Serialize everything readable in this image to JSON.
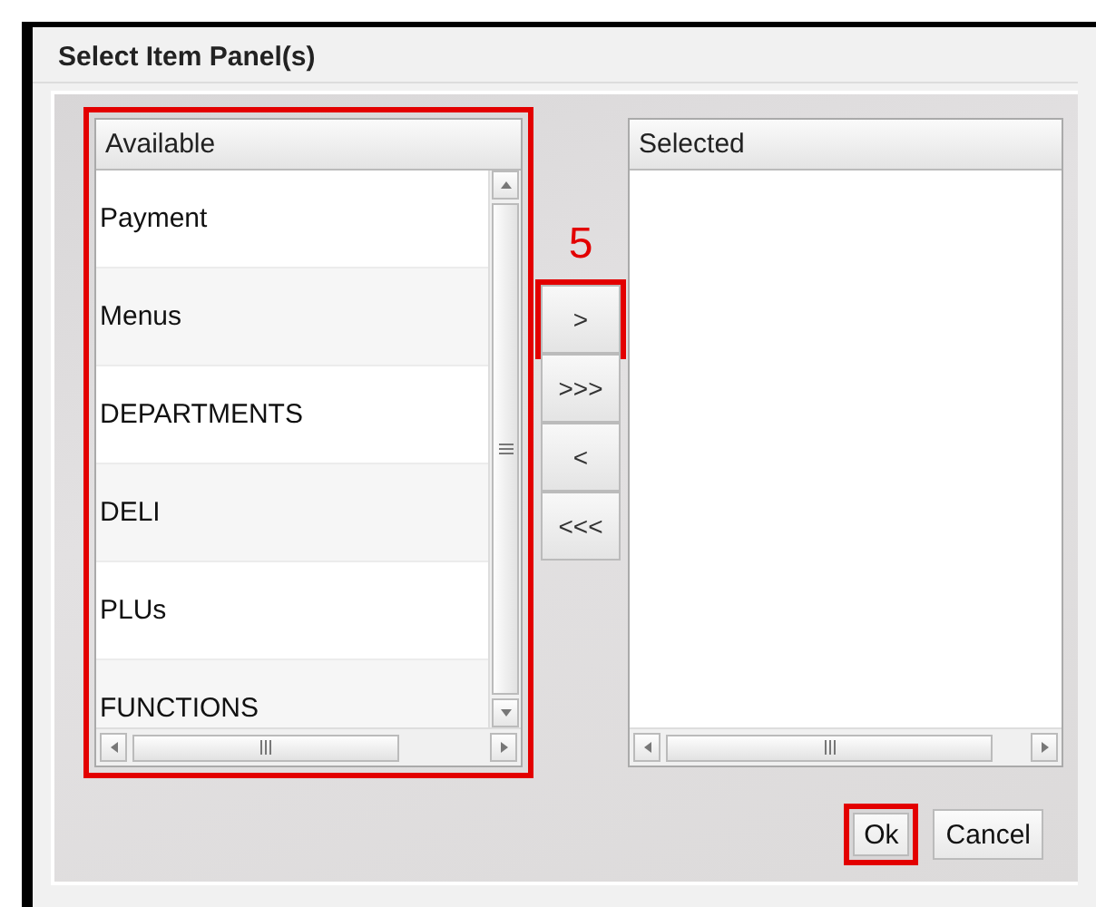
{
  "dialog": {
    "title": "Select Item Panel(s)"
  },
  "available": {
    "heading": "Available",
    "highlighted": true,
    "items": [
      {
        "label": "Payment"
      },
      {
        "label": "Menus"
      },
      {
        "label": "DEPARTMENTS"
      },
      {
        "label": "DELI"
      },
      {
        "label": "PLUs"
      },
      {
        "label": "FUNCTIONS"
      }
    ]
  },
  "selected_list": {
    "heading": "Selected"
  },
  "step_marker": "5",
  "move_buttons": [
    {
      "label": ">",
      "highlighted": true
    },
    {
      "label": ">>>",
      "highlighted": false
    },
    {
      "label": "<",
      "highlighted": false
    },
    {
      "label": "<<<",
      "highlighted": false
    }
  ],
  "footer_buttons": [
    {
      "label": "Ok",
      "highlighted": true
    },
    {
      "label": "Cancel",
      "highlighted": false
    }
  ]
}
